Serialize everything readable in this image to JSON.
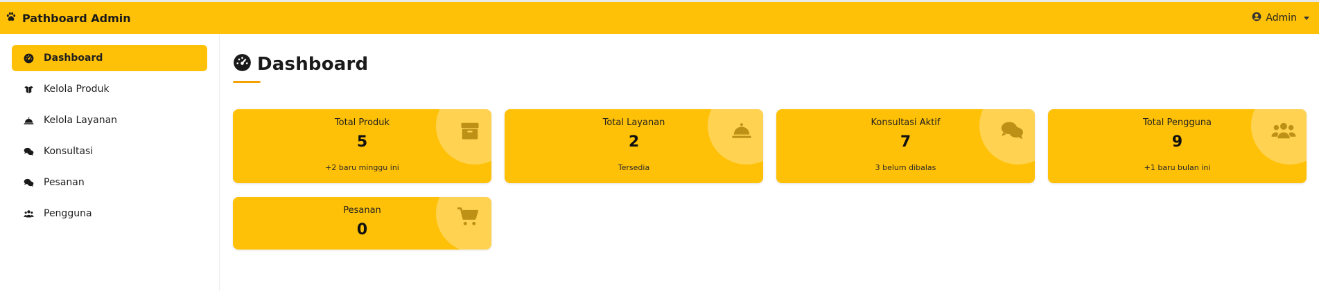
{
  "topbar": {
    "brand": "Pathboard Admin",
    "brand_icon": "paw-icon",
    "user_label": "Admin",
    "bg_color": "#ffc107"
  },
  "sidebar": {
    "items": [
      {
        "label": "Dashboard",
        "icon": "gauge-icon",
        "active": true
      },
      {
        "label": "Kelola Produk",
        "icon": "box-open-icon",
        "active": false
      },
      {
        "label": "Kelola Layanan",
        "icon": "bell-concierge-icon",
        "active": false
      },
      {
        "label": "Konsultasi",
        "icon": "comments-icon",
        "active": false
      },
      {
        "label": "Pesanan",
        "icon": "comments-icon",
        "active": false
      },
      {
        "label": "Pengguna",
        "icon": "users-icon",
        "active": false
      }
    ]
  },
  "main": {
    "title": "Dashboard",
    "title_icon": "gauge-icon",
    "cards": [
      {
        "title": "Total Produk",
        "value": "5",
        "subtitle": "+2 baru minggu ini",
        "icon": "box-icon"
      },
      {
        "title": "Total Layanan",
        "value": "2",
        "subtitle": "Tersedia",
        "icon": "bell-concierge-icon"
      },
      {
        "title": "Konsultasi Aktif",
        "value": "7",
        "subtitle": "3 belum dibalas",
        "icon": "comments-icon"
      },
      {
        "title": "Total Pengguna",
        "value": "9",
        "subtitle": "+1 baru bulan ini",
        "icon": "users-icon"
      },
      {
        "title": "Pesanan",
        "value": "0",
        "subtitle": "",
        "icon": "cart-icon"
      }
    ]
  },
  "colors": {
    "accent": "#ffc107",
    "underline": "#f5a100"
  }
}
